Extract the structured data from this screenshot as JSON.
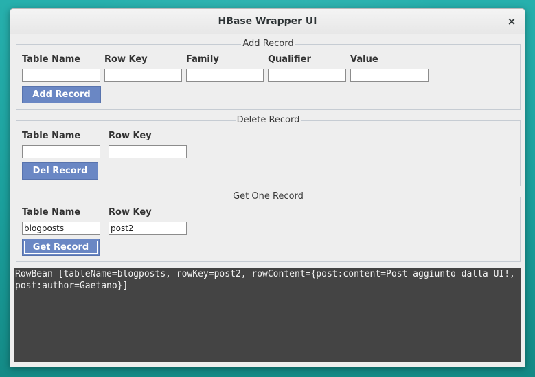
{
  "window": {
    "title": "HBase Wrapper UI",
    "close_glyph": "×"
  },
  "add_record": {
    "legend": "Add Record",
    "labels": {
      "table_name": "Table Name",
      "row_key": "Row Key",
      "family": "Family",
      "qualifier": "Qualifier",
      "value": "Value"
    },
    "values": {
      "table_name": "",
      "row_key": "",
      "family": "",
      "qualifier": "",
      "value": ""
    },
    "button": "Add Record"
  },
  "delete_record": {
    "legend": "Delete Record",
    "labels": {
      "table_name": "Table Name",
      "row_key": "Row Key"
    },
    "values": {
      "table_name": "",
      "row_key": ""
    },
    "button": "Del Record"
  },
  "get_record": {
    "legend": "Get One Record",
    "labels": {
      "table_name": "Table Name",
      "row_key": "Row Key"
    },
    "values": {
      "table_name": "blogposts",
      "row_key": "post2"
    },
    "button": "Get Record"
  },
  "output": {
    "text": "RowBean [tableName=blogposts, rowKey=post2, rowContent={post:content=Post aggiunto dalla UI!, post:author=Gaetano}]"
  },
  "colors": {
    "desktop": "#1ea7a4",
    "button": "#6a87c4",
    "output_bg": "#444444"
  }
}
